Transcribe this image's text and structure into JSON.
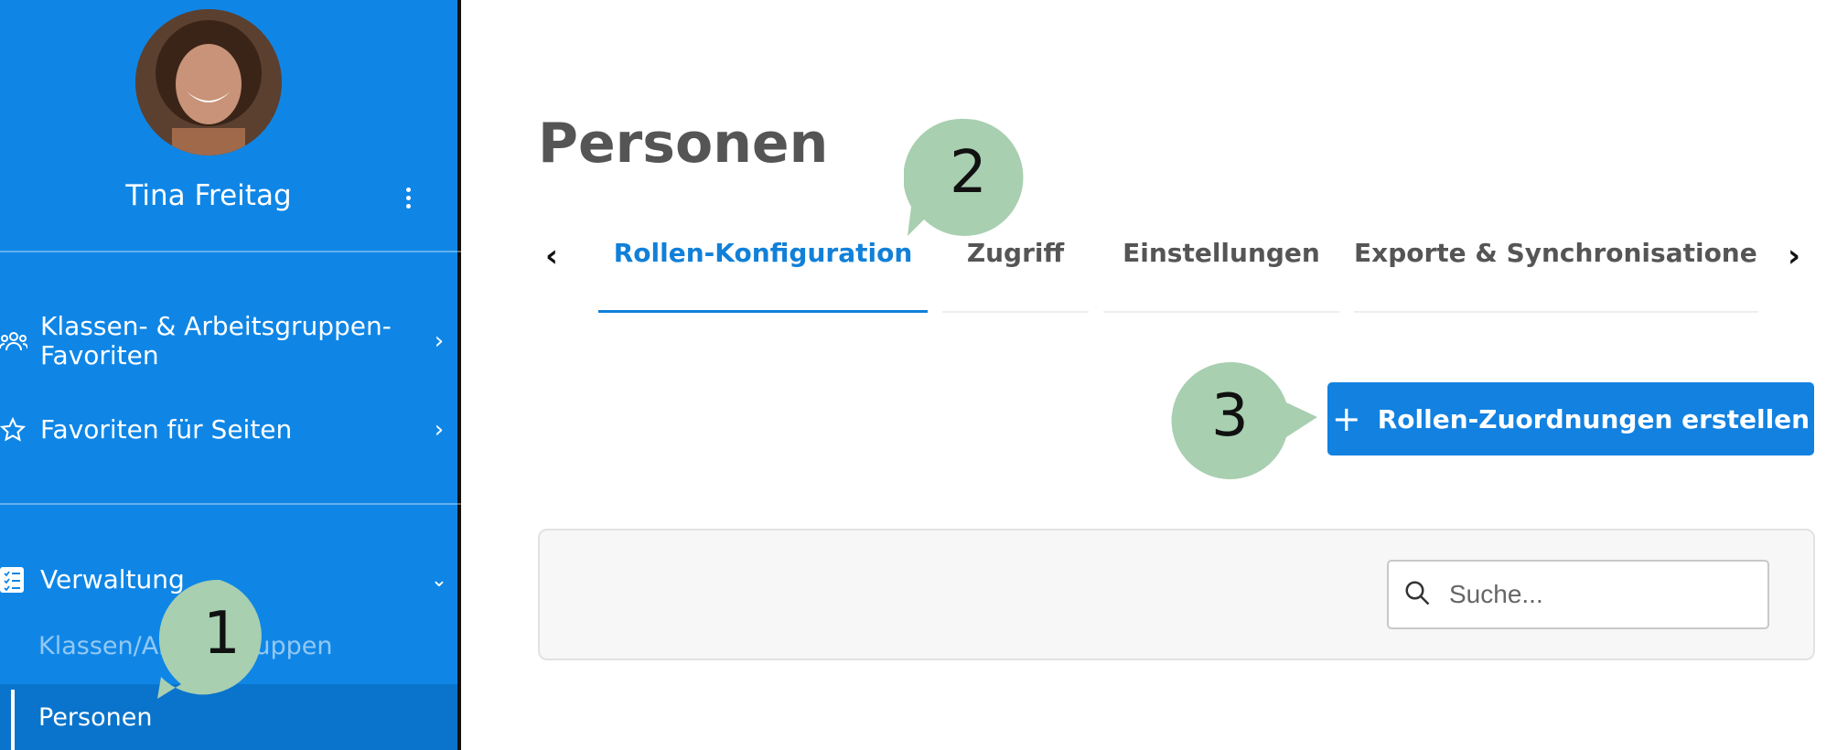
{
  "sidebar": {
    "user_name": "Tina Freitag",
    "items": [
      {
        "label_line1": "Klassen- & Arbeitsgruppen-",
        "label_line2": "Favoriten",
        "icon": "group-icon"
      },
      {
        "label": "Favoriten für Seiten",
        "icon": "star-icon"
      },
      {
        "label": "Verwaltung",
        "icon": "checklist-icon"
      }
    ],
    "sub_items": [
      {
        "label": "Klassen/Arbeitsgruppen"
      },
      {
        "label": "Personen"
      }
    ]
  },
  "main": {
    "title": "Personen",
    "tabs": [
      {
        "label": "Rollen-Konfiguration",
        "active": true
      },
      {
        "label": "Zugriff"
      },
      {
        "label": "Einstellungen"
      },
      {
        "label": "Exporte & Synchronisationen"
      }
    ],
    "create_button_label": "Rollen-Zuordnungen erstellen",
    "search_placeholder": "Suche..."
  },
  "callouts": [
    "1",
    "2",
    "3"
  ],
  "colors": {
    "sidebar_bg": "#0f86e6",
    "accent": "#1180d8",
    "callout": "#a8cfb0"
  }
}
